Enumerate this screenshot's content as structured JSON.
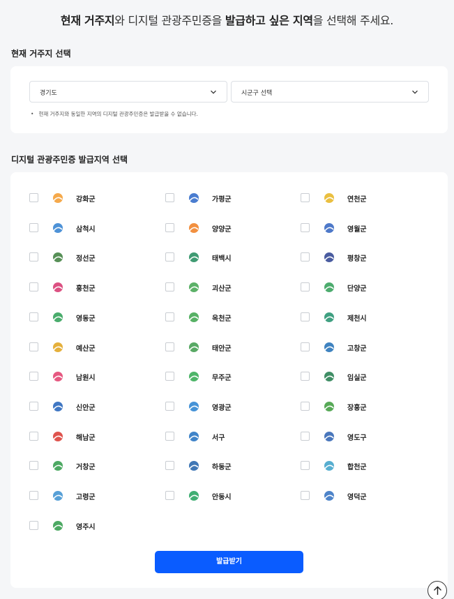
{
  "header": {
    "title_parts": [
      {
        "text": "현재 거주지",
        "bold": true
      },
      {
        "text": "와 디지털 관광주민증을 ",
        "bold": false
      },
      {
        "text": "발급하고 싶은 지역",
        "bold": true
      },
      {
        "text": "을 선택해 주세요.",
        "bold": false
      }
    ]
  },
  "residence": {
    "section_label": "현재 거주지 선택",
    "province_value": "경기도",
    "city_value": "시군구 선택",
    "notice": "현재 거주지와 동일한 지역의 디지털 관광주민증은 발급받을 수 없습니다."
  },
  "regions": {
    "section_label": "디지털 관광주민증 발급지역 선택",
    "items": [
      {
        "name": "강화군",
        "icon": "ganghwa-logo-icon",
        "color": "#f39a2b"
      },
      {
        "name": "가평군",
        "icon": "gapyeong-logo-icon",
        "color": "#2a66c8"
      },
      {
        "name": "연천군",
        "icon": "yeoncheon-logo-icon",
        "color": "#e6b41e"
      },
      {
        "name": "삼척시",
        "icon": "samcheok-logo-icon",
        "color": "#2f7fd0"
      },
      {
        "name": "양양군",
        "icon": "yangyang-logo-icon",
        "color": "#f07c1e"
      },
      {
        "name": "영월군",
        "icon": "yeongwol-logo-icon",
        "color": "#2f62c0"
      },
      {
        "name": "정선군",
        "icon": "jeongseon-logo-icon",
        "color": "#3a7d3a"
      },
      {
        "name": "태백시",
        "icon": "taebaek-logo-icon",
        "color": "#1f8a5a"
      },
      {
        "name": "평창군",
        "icon": "pyeongchang-logo-icon",
        "color": "#2a3f8f"
      },
      {
        "name": "홍천군",
        "icon": "hongcheon-logo-icon",
        "color": "#d6336c"
      },
      {
        "name": "괴산군",
        "icon": "goesan-logo-icon",
        "color": "#3fa34d"
      },
      {
        "name": "단양군",
        "icon": "danyang-logo-icon",
        "color": "#2e9e55"
      },
      {
        "name": "영동군",
        "icon": "yeongdong-logo-icon",
        "color": "#2a9d52"
      },
      {
        "name": "옥천군",
        "icon": "okcheon-logo-icon",
        "color": "#39a34a"
      },
      {
        "name": "제천시",
        "icon": "jecheon-logo-icon",
        "color": "#1f8f6b"
      },
      {
        "name": "예산군",
        "icon": "yesan-logo-icon",
        "color": "#e0a21a"
      },
      {
        "name": "태안군",
        "icon": "taean-logo-icon",
        "color": "#3c9a4a"
      },
      {
        "name": "고창군",
        "icon": "gochang-logo-icon",
        "color": "#1f6db5"
      },
      {
        "name": "남원시",
        "icon": "namwon-logo-icon",
        "color": "#e23c6b"
      },
      {
        "name": "무주군",
        "icon": "muju-logo-icon",
        "color": "#2fa84f"
      },
      {
        "name": "임실군",
        "icon": "imsil-logo-icon",
        "color": "#1f7a4a"
      },
      {
        "name": "신안군",
        "icon": "sinan-logo-icon",
        "color": "#1f5fb8"
      },
      {
        "name": "영광군",
        "icon": "yeonggwang-logo-icon",
        "color": "#2680d0"
      },
      {
        "name": "장흥군",
        "icon": "jangheung-logo-icon",
        "color": "#3a9a3a"
      },
      {
        "name": "해남군",
        "icon": "haenam-logo-icon",
        "color": "#d9362f"
      },
      {
        "name": "서구",
        "icon": "seogu-logo-icon",
        "color": "#1e6fbf"
      },
      {
        "name": "영도구",
        "icon": "yeongdo-logo-icon",
        "color": "#2a5fb0"
      },
      {
        "name": "거창군",
        "icon": "geochang-logo-icon",
        "color": "#2e9a48"
      },
      {
        "name": "하동군",
        "icon": "hadong-logo-icon",
        "color": "#1f5fa8"
      },
      {
        "name": "합천군",
        "icon": "hapcheon-logo-icon",
        "color": "#3aa0c8"
      },
      {
        "name": "고령군",
        "icon": "goryeong-logo-icon",
        "color": "#3a8fd0"
      },
      {
        "name": "안동시",
        "icon": "andong-logo-icon",
        "color": "#1fa05a"
      },
      {
        "name": "영덕군",
        "icon": "yeongdeok-logo-icon",
        "color": "#2f6fc0"
      },
      {
        "name": "영주시",
        "icon": "yeongju-logo-icon",
        "color": "#2e9a48"
      }
    ]
  },
  "actions": {
    "issue_label": "발급받기"
  },
  "scroll_top_icon": "arrow-up-icon"
}
